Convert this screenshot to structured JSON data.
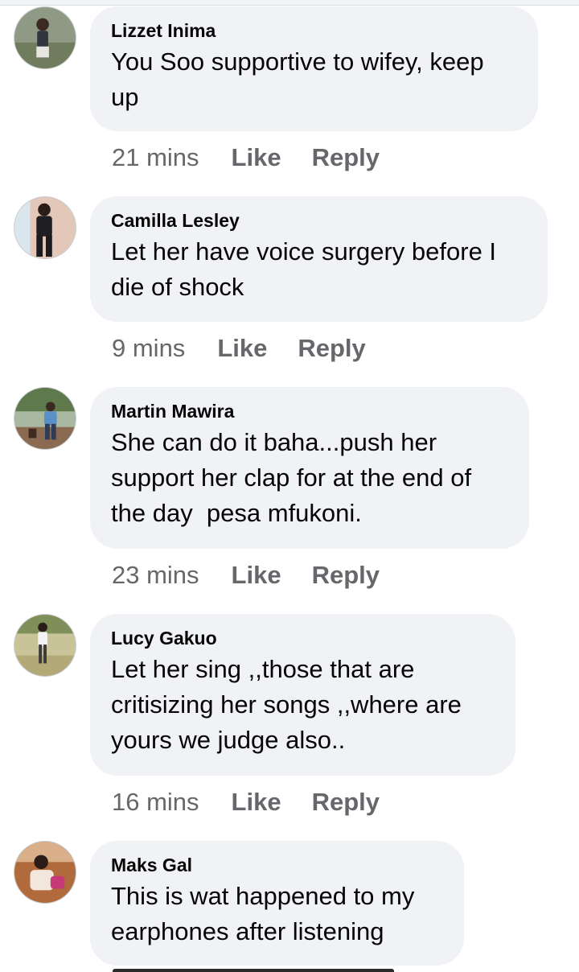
{
  "comments": [
    {
      "author": "Lizzet Inima",
      "text": "You Soo supportive to wifey, keep\nup",
      "time": "21 mins",
      "like": "Like",
      "reply": "Reply",
      "avatar_icon": "profile-photo-icon"
    },
    {
      "author": "Camilla Lesley",
      "text": "Let her have voice surgery before I\ndie of shock",
      "time": "9 mins",
      "like": "Like",
      "reply": "Reply",
      "avatar_icon": "profile-photo-icon"
    },
    {
      "author": "Martin Mawira",
      "text": "She can do it baha...push her\nsupport her clap for at the end of\nthe day  pesa mfukoni.",
      "time": "23 mins",
      "like": "Like",
      "reply": "Reply",
      "avatar_icon": "profile-photo-icon"
    },
    {
      "author": "Lucy Gakuo",
      "text": "Let her sing ,,those that are\ncritisizing her songs ,,where are\nyours we judge also..",
      "time": "16 mins",
      "like": "Like",
      "reply": "Reply",
      "avatar_icon": "profile-photo-icon"
    },
    {
      "author": "Maks Gal",
      "text": "This is wat happened to my\nearphones after listening",
      "avatar_icon": "profile-photo-icon"
    }
  ]
}
